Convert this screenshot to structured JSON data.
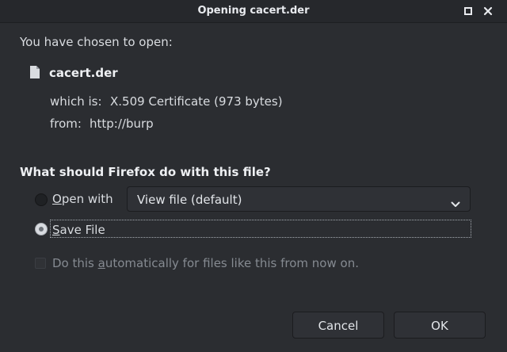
{
  "window": {
    "title": "Opening cacert.der"
  },
  "dialog": {
    "intro": "You have chosen to open:",
    "filename": "cacert.der",
    "which_is_label": "which is:",
    "which_is_value": "X.509 Certificate (973 bytes)",
    "from_label": "from:",
    "from_value": "http://burp",
    "question": "What should Firefox do with this file?",
    "open_with": {
      "label_first": "O",
      "label_rest": "pen with",
      "selected": false,
      "dropdown_value": "View file (default)"
    },
    "save_file": {
      "label_first": "S",
      "label_rest": "ave File",
      "selected": true
    },
    "auto_checkbox": {
      "label_before": "Do this ",
      "label_underlined": "a",
      "label_after": "utomatically for files like this from now on.",
      "checked": false,
      "enabled": false
    }
  },
  "buttons": {
    "cancel": "Cancel",
    "ok": "OK"
  }
}
